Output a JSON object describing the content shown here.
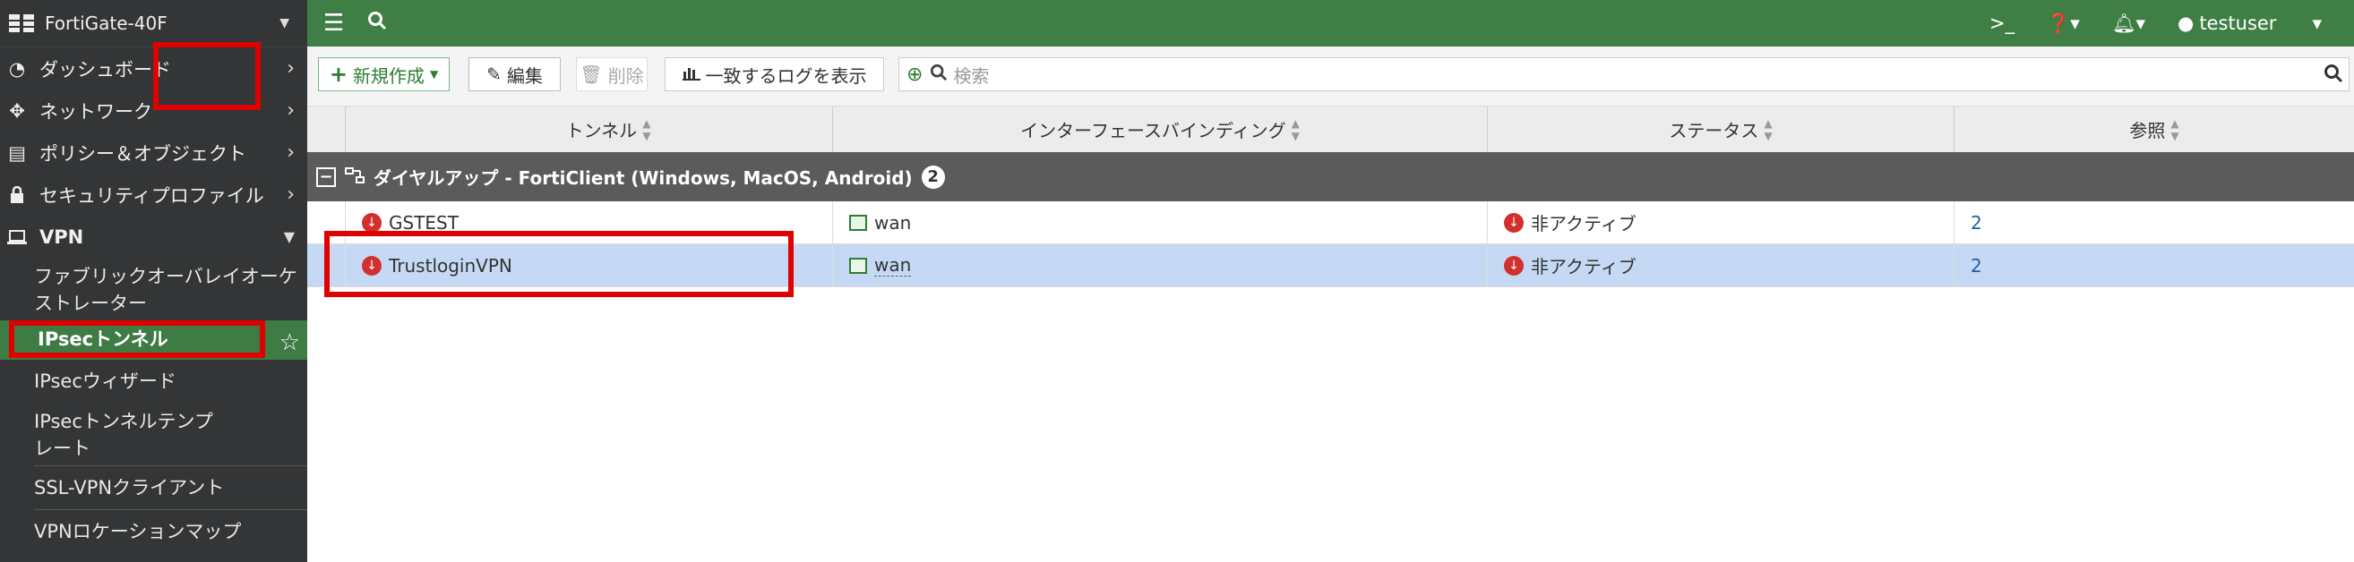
{
  "device": {
    "name": "FortiGate-40F"
  },
  "sidebar": {
    "items": [
      {
        "label": "ダッシュボード"
      },
      {
        "label": "ネットワーク"
      },
      {
        "label": "ポリシー＆オブジェクト"
      },
      {
        "label": "セキュリティプロファイル"
      },
      {
        "label": "VPN"
      }
    ],
    "vpn_sub": [
      {
        "label": "ファブリックオーバレイオーケストレーター"
      },
      {
        "label": "IPsecトンネル"
      },
      {
        "label": "IPsecウィザード"
      },
      {
        "label": "IPsecトンネルテンプレート"
      },
      {
        "label": "SSL-VPNクライアント"
      },
      {
        "label": "VPNロケーションマップ"
      }
    ]
  },
  "topbar": {
    "user": "testuser"
  },
  "toolbar": {
    "new_label": "新規作成",
    "edit_label": "編集",
    "delete_label": "削除",
    "log_label": "一致するログを表示",
    "search_placeholder": "検索"
  },
  "table": {
    "columns": [
      "トンネル",
      "インターフェースバインディング",
      "ステータス",
      "参照"
    ],
    "group": {
      "label": "ダイヤルアップ - FortiClient (Windows, MacOS, Android)",
      "count": "2"
    },
    "rows": [
      {
        "tunnel": "GSTEST",
        "interface": "wan",
        "status": "非アクティブ",
        "ref": "2"
      },
      {
        "tunnel": "TrustloginVPN",
        "interface": "wan",
        "status": "非アクティブ",
        "ref": "2"
      }
    ]
  },
  "colors": {
    "topbar": "#3f7f46",
    "sidebar": "#333536",
    "highlight": "#e00000",
    "selected_row": "#c5d9f5"
  }
}
